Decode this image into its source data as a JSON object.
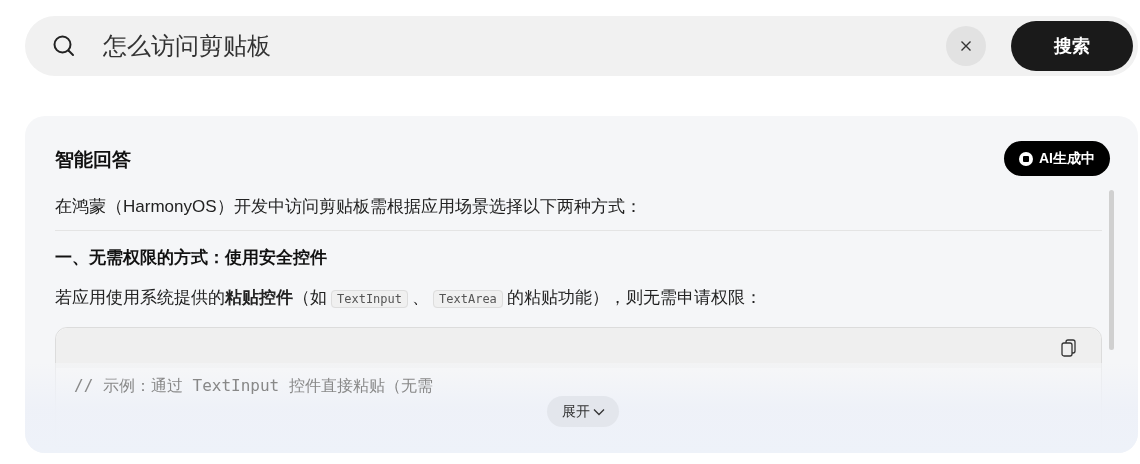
{
  "search": {
    "value": "怎么访问剪贴板",
    "button": "搜索"
  },
  "answer": {
    "title": "智能回答",
    "badge": "AI生成中",
    "intro": "在鸿蒙（HarmonyOS）开发中访问剪贴板需根据应用场景选择以下两种方式：",
    "heading": "一、无需权限的方式：使用安全控件",
    "paragraph": [
      {
        "kind": "text",
        "text": "若应用使用系统提供的"
      },
      {
        "kind": "bold",
        "text": "粘贴控件"
      },
      {
        "kind": "text",
        "text": "（如"
      },
      {
        "kind": "code",
        "text": "TextInput"
      },
      {
        "kind": "text",
        "text": "、"
      },
      {
        "kind": "code",
        "text": "TextArea"
      },
      {
        "kind": "text",
        "text": "的粘贴功能），则无需申请权限："
      }
    ],
    "code_line": "// 示例：通过 TextInput 控件直接粘贴（无需",
    "expand": "展开"
  }
}
